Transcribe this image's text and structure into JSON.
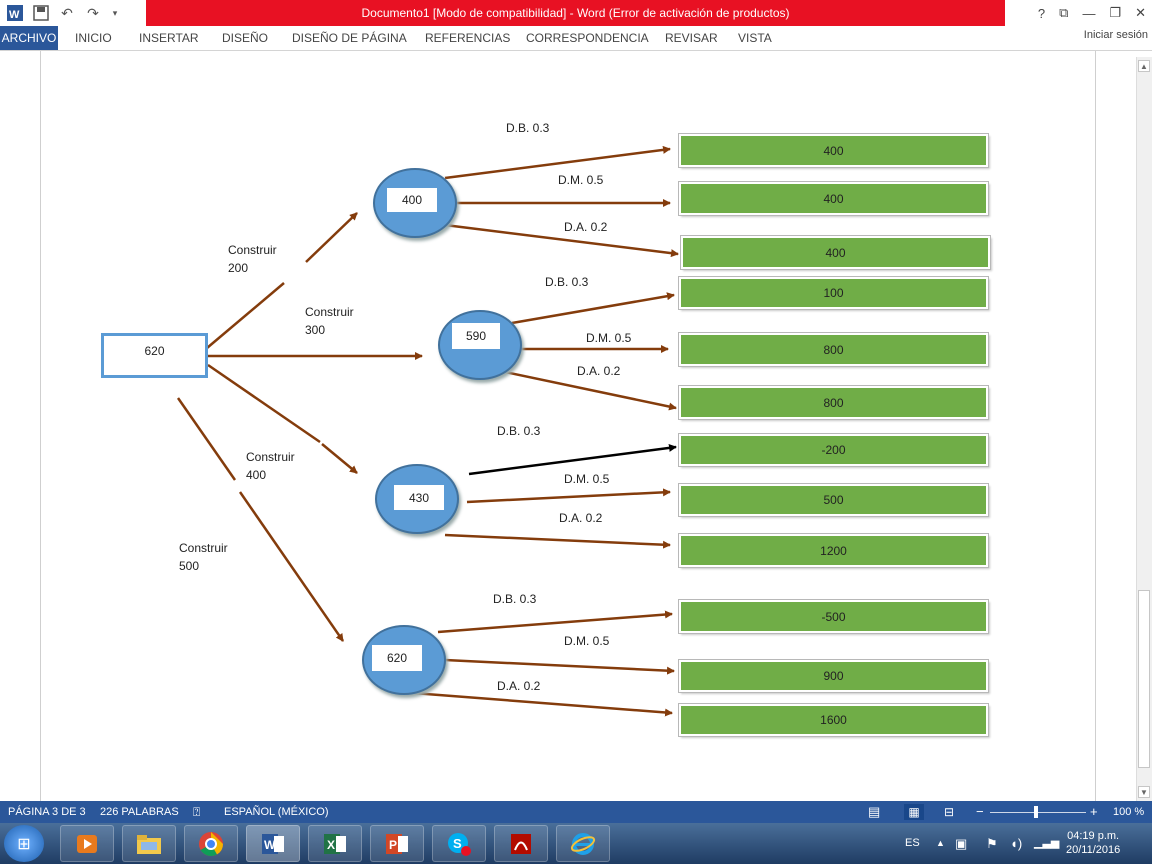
{
  "titlebar": {
    "title": "Documento1 [Modo de compatibilidad] -  Word (Error de activación de productos)",
    "buttons": {
      "help": "?",
      "ribbon_display": "⧉",
      "minimize": "—",
      "restore": "❐",
      "close": "✕"
    }
  },
  "ribbon": {
    "tabs": [
      "ARCHIVO",
      "INICIO",
      "INSERTAR",
      "DISEÑO",
      "DISEÑO DE PÁGINA",
      "REFERENCIAS",
      "CORRESPONDENCIA",
      "REVISAR",
      "VISTA"
    ],
    "signin": "Iniciar sesión"
  },
  "diagram": {
    "root": "620",
    "decisions": [
      {
        "label": "Construir",
        "cost": "200",
        "node_value": "400"
      },
      {
        "label": "Construir",
        "cost": "300",
        "node_value": "590"
      },
      {
        "label": "Construir",
        "cost": "400",
        "node_value": "430"
      },
      {
        "label": "Construir",
        "cost": "500",
        "node_value": "620"
      }
    ],
    "branch_labels": {
      "db": "D.B. 0.3",
      "dm": "D.M. 0.5",
      "da": "D.A. 0.2"
    },
    "outcomes": [
      [
        "400",
        "400",
        "400"
      ],
      [
        "100",
        "800",
        "800"
      ],
      [
        "-200",
        "500",
        "1200"
      ],
      [
        "-500",
        "900",
        "1600"
      ]
    ],
    "colors": {
      "arrow": "#843c0c",
      "arrow_black": "#000000",
      "node": "#5b9bd5",
      "leaf": "#70ad47"
    }
  },
  "statusbar": {
    "page": "PÁGINA 3 DE 3",
    "words": "226 PALABRAS",
    "language": "ESPAÑOL (MÉXICO)",
    "zoom": "100 %"
  },
  "taskbar": {
    "apps": [
      "media-player",
      "file-explorer",
      "chrome",
      "word",
      "excel",
      "powerpoint",
      "skype",
      "acrobat",
      "internet-explorer"
    ],
    "tray": {
      "lang": "ES",
      "time": "04:19 p.m.",
      "date": "20/11/2016"
    }
  }
}
